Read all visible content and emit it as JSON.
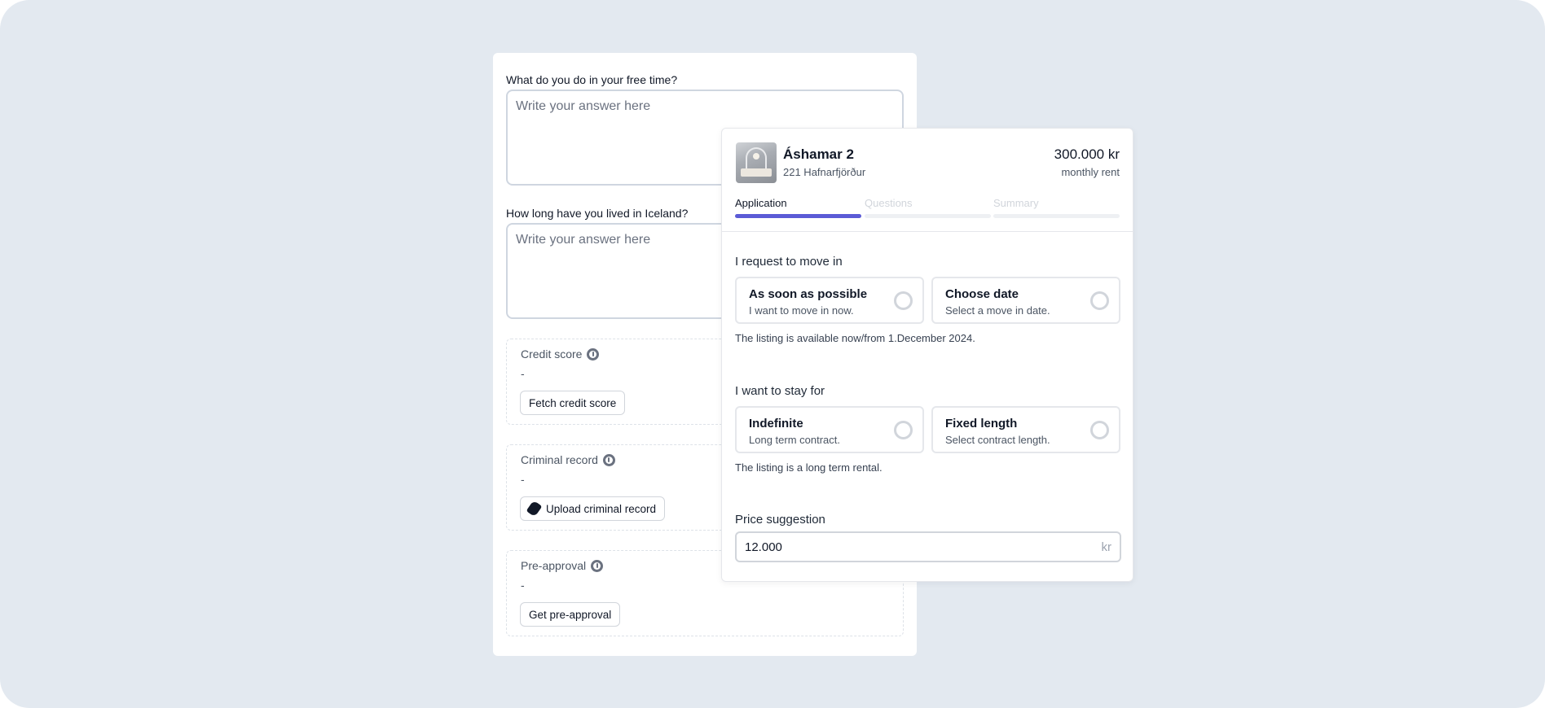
{
  "form": {
    "q1": {
      "label": "What do you do in your free time?",
      "placeholder": "Write your answer here"
    },
    "q2": {
      "label": "How long have you lived in Iceland?",
      "placeholder": "Write your answer here"
    },
    "checks": [
      {
        "title": "Credit score",
        "value": "-",
        "button": "Fetch credit score",
        "icon": "info-icon"
      },
      {
        "title": "Criminal record",
        "value": "-",
        "button": "Upload criminal record",
        "button_icon": "paperclip-icon",
        "icon": "info-icon"
      },
      {
        "title": "Pre-approval",
        "value": "-",
        "button": "Get pre-approval",
        "icon": "info-icon"
      }
    ]
  },
  "application": {
    "property": {
      "name": "Áshamar 2",
      "address": "221 Hafnarfjörður",
      "price": "300.000 kr",
      "price_label": "monthly rent"
    },
    "steps": [
      {
        "label": "Application",
        "active": true
      },
      {
        "label": "Questions",
        "active": false
      },
      {
        "label": "Summary",
        "active": false
      }
    ],
    "accent_color": "#5b5bd6",
    "move_in": {
      "title": "I request to move in",
      "options": [
        {
          "title": "As soon as possible",
          "subtitle": "I want to move in now."
        },
        {
          "title": "Choose date",
          "subtitle": "Select a move in date."
        }
      ],
      "note": "The listing is available now/from 1.December 2024."
    },
    "stay": {
      "title": "I want to stay for",
      "options": [
        {
          "title": "Indefinite",
          "subtitle": "Long term contract."
        },
        {
          "title": "Fixed length",
          "subtitle": "Select contract length."
        }
      ],
      "note": "The listing is a long term rental."
    },
    "price_suggestion": {
      "title": "Price suggestion",
      "value": "12.000",
      "unit": "kr"
    }
  }
}
